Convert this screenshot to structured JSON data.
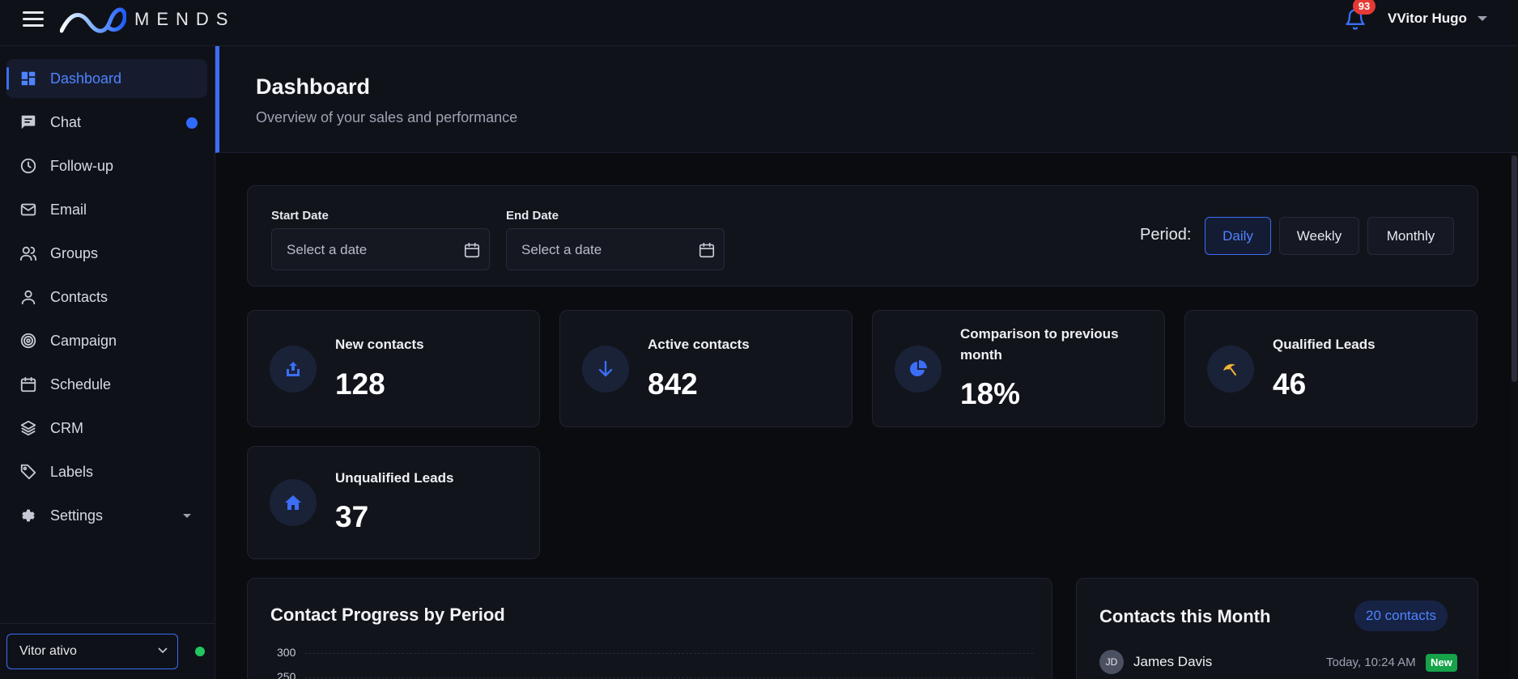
{
  "app": {
    "logo_text": "MENDS"
  },
  "topbar": {
    "notifications_count": "93",
    "user_name": "VVitor Hugo"
  },
  "sidebar": {
    "items": [
      {
        "label": "Dashboard",
        "icon": "dashboard-icon",
        "active": true
      },
      {
        "label": "Chat",
        "icon": "chat-icon",
        "unread_dot": true
      },
      {
        "label": "Follow-up",
        "icon": "clock-icon"
      },
      {
        "label": "Email",
        "icon": "mail-icon"
      },
      {
        "label": "Groups",
        "icon": "users-icon"
      },
      {
        "label": "Contacts",
        "icon": "user-icon"
      },
      {
        "label": "Campaign",
        "icon": "target-icon"
      },
      {
        "label": "Schedule",
        "icon": "calendar-icon"
      },
      {
        "label": "CRM",
        "icon": "layers-icon"
      },
      {
        "label": "Labels",
        "icon": "tag-icon"
      },
      {
        "label": "Settings",
        "icon": "gear-icon",
        "has_submenu": true
      }
    ],
    "status_select": {
      "value": "Vitor ativo",
      "status_color": "#22c55e"
    }
  },
  "header": {
    "title": "Dashboard",
    "subtitle": "Overview of your sales and performance"
  },
  "filters": {
    "start_label": "Start Date",
    "end_label": "End Date",
    "date_placeholder": "Select a date",
    "period_label": "Period:",
    "periods": [
      "Daily",
      "Weekly",
      "Monthly"
    ],
    "active_period": "Daily"
  },
  "stats": [
    {
      "label": "New contacts",
      "value": "128",
      "icon": "share-icon"
    },
    {
      "label": "Active contacts",
      "value": "842",
      "icon": "arrow-down-icon"
    },
    {
      "label": "Comparison to previous month",
      "value": "18%",
      "icon": "pie-chart-icon"
    },
    {
      "label": "Qualified Leads",
      "value": "46",
      "icon": "umbrella-icon"
    },
    {
      "label": "Unqualified Leads",
      "value": "37",
      "icon": "home-icon"
    }
  ],
  "chart": {
    "title": "Contact Progress by Period",
    "y_ticks": [
      "300",
      "250"
    ]
  },
  "contacts_month": {
    "title": "Contacts this Month",
    "count_label": "20 contacts",
    "items": [
      {
        "initials": "JD",
        "name": "James Davis",
        "time": "Today, 10:24 AM",
        "badge": "New"
      }
    ]
  },
  "colors": {
    "accent": "#3b6ef5",
    "background": "#0b0c10",
    "card": "#12141c",
    "success": "#16a34a",
    "danger": "#e53935"
  }
}
